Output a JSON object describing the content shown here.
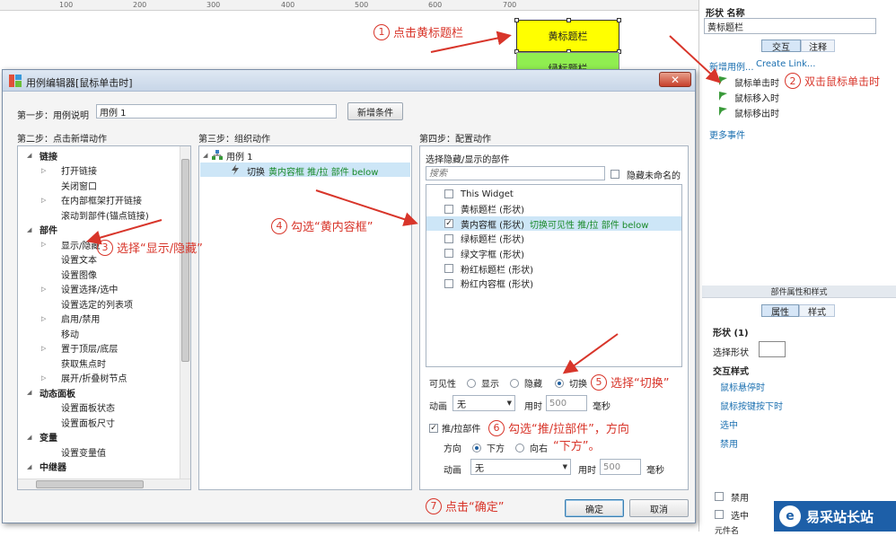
{
  "ruler": {
    "ticks": [
      "100",
      "200",
      "300",
      "400",
      "500",
      "600",
      "700"
    ]
  },
  "canvas": {
    "yellow_widget": "黄标题栏",
    "green_widget": "绿标题栏"
  },
  "right_panel": {
    "header": "形状 名称",
    "name_value": "黄标题栏",
    "tab_interaction": "交互",
    "tab_notes": "注释",
    "new_case_link": "新增用例...",
    "create_link": "Create Link...",
    "events": [
      "鼠标单击时",
      "鼠标移入时",
      "鼠标移出时"
    ],
    "more_events": "更多事件",
    "props_title": "部件属性和样式",
    "tab_props": "属性",
    "tab_style": "样式",
    "shape_section": "形状 (1)",
    "select_shape_label": "选择形状",
    "interaction_style": "交互样式",
    "style_links": [
      "鼠标悬停时",
      "鼠标按键按下时",
      "选中",
      "禁用"
    ],
    "disabled_label": "禁用",
    "checked_label": "选中",
    "partial_label": "元件名"
  },
  "dialog": {
    "title": "用例编辑器[鼠标单击时]",
    "close_label": "✕",
    "step1_label": "第一步：用例说明",
    "case_name": "用例 1",
    "add_condition": "新增条件",
    "step2_label": "第二步：点击新增动作",
    "step3_label": "第三步：组织动作",
    "step4_label": "第四步：配置动作",
    "actions_tree": [
      {
        "text": "链接",
        "type": "cat"
      },
      {
        "text": "打开链接",
        "type": "item",
        "expand": true
      },
      {
        "text": "关闭窗口",
        "type": "item"
      },
      {
        "text": "在内部框架打开链接",
        "type": "item",
        "expand": true
      },
      {
        "text": "滚动到部件(锚点链接)",
        "type": "item"
      },
      {
        "text": "部件",
        "type": "cat"
      },
      {
        "text": "显示/隐藏",
        "type": "item",
        "expand": true
      },
      {
        "text": "设置文本",
        "type": "item"
      },
      {
        "text": "设置图像",
        "type": "item"
      },
      {
        "text": "设置选择/选中",
        "type": "item",
        "expand": true
      },
      {
        "text": "设置选定的列表项",
        "type": "item"
      },
      {
        "text": "启用/禁用",
        "type": "item",
        "expand": true
      },
      {
        "text": "移动",
        "type": "item"
      },
      {
        "text": "置于顶层/底层",
        "type": "item",
        "expand": true
      },
      {
        "text": "获取焦点时",
        "type": "item"
      },
      {
        "text": "展开/折叠树节点",
        "type": "item",
        "expand": true
      },
      {
        "text": "动态面板",
        "type": "cat"
      },
      {
        "text": "设置面板状态",
        "type": "item"
      },
      {
        "text": "设置面板尺寸",
        "type": "item"
      },
      {
        "text": "变量",
        "type": "cat"
      },
      {
        "text": "设置变量值",
        "type": "item"
      },
      {
        "text": "中继器",
        "type": "cat"
      }
    ],
    "case_tree_root": "用例 1",
    "case_action_prefix": "切换",
    "case_action_detail": "黄内容框 推/拉 部件 below",
    "select_widgets_label": "选择隐藏/显示的部件",
    "search_placeholder": "搜索",
    "hide_unnamed": "隐藏未命名的",
    "widgets": [
      {
        "name": "This Widget",
        "checked": false,
        "detail": ""
      },
      {
        "name": "黄标题栏 (形状)",
        "checked": false,
        "detail": ""
      },
      {
        "name": "黄内容框 (形状)",
        "checked": true,
        "detail": "切换可见性 推/拉 部件 below"
      },
      {
        "name": "绿标题栏 (形状)",
        "checked": false,
        "detail": ""
      },
      {
        "name": "绿文字框 (形状)",
        "checked": false,
        "detail": ""
      },
      {
        "name": "粉红标题栏 (形状)",
        "checked": false,
        "detail": ""
      },
      {
        "name": "粉红内容框 (形状)",
        "checked": false,
        "detail": ""
      }
    ],
    "visibility_label": "可见性",
    "opt_show": "显示",
    "opt_hide": "隐藏",
    "opt_toggle": "切换",
    "animation_label": "动画",
    "animation_value": "无",
    "duration_label": "用时",
    "duration_value": "500",
    "ms_label": "毫秒",
    "push_pull_label": "推/拉部件",
    "direction_label": "方向",
    "dir_down": "下方",
    "dir_right": "向右",
    "animation2_value": "无",
    "duration2_value": "500",
    "ok": "确定",
    "cancel": "取消"
  },
  "annotations": [
    {
      "num": "1",
      "text": "点击黄标题栏"
    },
    {
      "num": "2",
      "text": "双击鼠标单击时"
    },
    {
      "num": "3",
      "text": "选择“显示/隐藏”"
    },
    {
      "num": "4",
      "text": "勾选“黄内容框”"
    },
    {
      "num": "5",
      "text": "选择“切换”"
    },
    {
      "num": "6",
      "text": "勾选“推/拉部件”，方向"
    },
    {
      "num": "7",
      "text": "点击“确定”"
    }
  ],
  "annotation6_line2": "“下方”。",
  "watermark": {
    "logo": "e",
    "text": "易采站长站"
  },
  "colors": {
    "annotation": "#d8352a",
    "link": "#1a6fb0",
    "highlight": "#cde6f7",
    "yellow": "#ffff00",
    "green": "#90ee50"
  }
}
